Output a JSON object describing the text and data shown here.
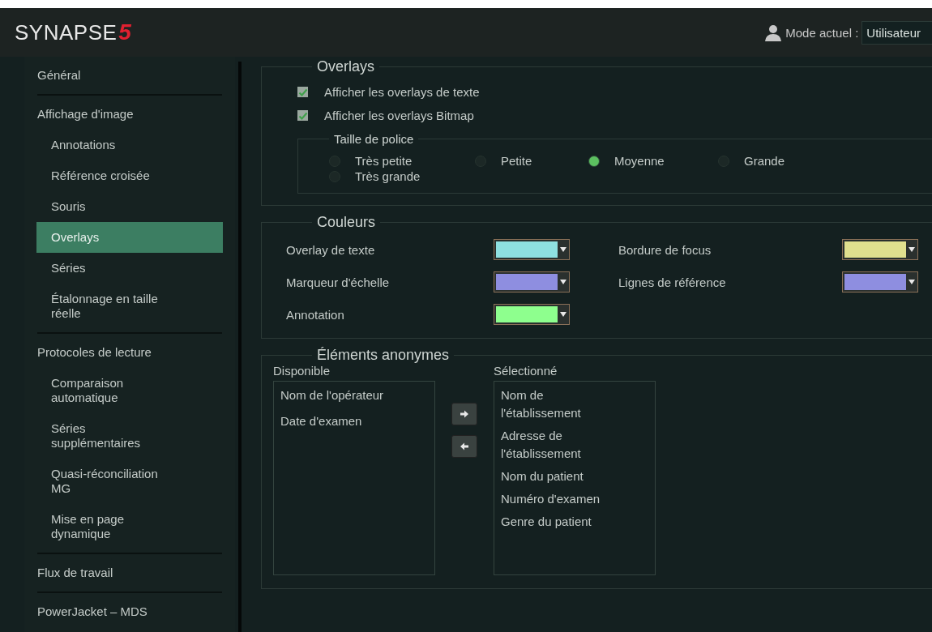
{
  "header": {
    "logo": {
      "name": "SYNAPSE",
      "mark": "5"
    },
    "mode_label": "Mode actuel :",
    "mode_value": "Utilisateur"
  },
  "sidebar": {
    "groups": [
      {
        "label": "Général",
        "selected": false
      },
      {
        "label": "Affichage d'image",
        "selected": false,
        "children": [
          {
            "label": "Annotations",
            "selected": false
          },
          {
            "label": "Référence croisée",
            "selected": false
          },
          {
            "label": "Souris",
            "selected": false
          },
          {
            "label": "Overlays",
            "selected": true
          },
          {
            "label": "Séries",
            "selected": false
          },
          {
            "label": "Étalonnage en taille réelle",
            "selected": false
          }
        ]
      },
      {
        "label": "Protocoles de lecture",
        "selected": false,
        "children": [
          {
            "label": "Comparaison automatique",
            "selected": false
          },
          {
            "label": "Séries supplémentaires",
            "selected": false
          },
          {
            "label": "Quasi-réconciliation MG",
            "selected": false
          },
          {
            "label": "Mise en page dynamique",
            "selected": false
          }
        ]
      },
      {
        "label": "Flux de travail",
        "selected": false
      },
      {
        "label": "PowerJacket – MDS",
        "selected": false
      }
    ]
  },
  "overlays": {
    "title": "Overlays",
    "checkboxes": [
      {
        "label": "Afficher les overlays de texte",
        "checked": true
      },
      {
        "label": "Afficher les overlays Bitmap",
        "checked": true
      }
    ],
    "font_size": {
      "title": "Taille de police",
      "options": [
        {
          "label": "Très petite",
          "selected": false
        },
        {
          "label": "Petite",
          "selected": false
        },
        {
          "label": "Moyenne",
          "selected": true
        },
        {
          "label": "Grande",
          "selected": false
        },
        {
          "label": "Très grande",
          "selected": false
        }
      ]
    }
  },
  "colors": {
    "title": "Couleurs",
    "items": [
      {
        "label": "Overlay de texte",
        "color": "#8ee0e0"
      },
      {
        "label": "Bordure de focus",
        "color": "#e0e08e"
      },
      {
        "label": "Marqueur d'échelle",
        "color": "#8e8ee0"
      },
      {
        "label": "Lignes de référence",
        "color": "#8e8ee0"
      },
      {
        "label": "Annotation",
        "color": "#8eff8e"
      }
    ]
  },
  "anonymous": {
    "title": "Éléments anonymes",
    "available": {
      "title": "Disponible",
      "items": [
        "Nom de l'opérateur",
        "Date d'examen"
      ]
    },
    "selected": {
      "title": "Sélectionné",
      "items": [
        "Nom de l'établissement",
        "Adresse de l'établissement",
        "Nom du patient",
        "Numéro d'examen",
        "Genre du patient"
      ]
    }
  }
}
